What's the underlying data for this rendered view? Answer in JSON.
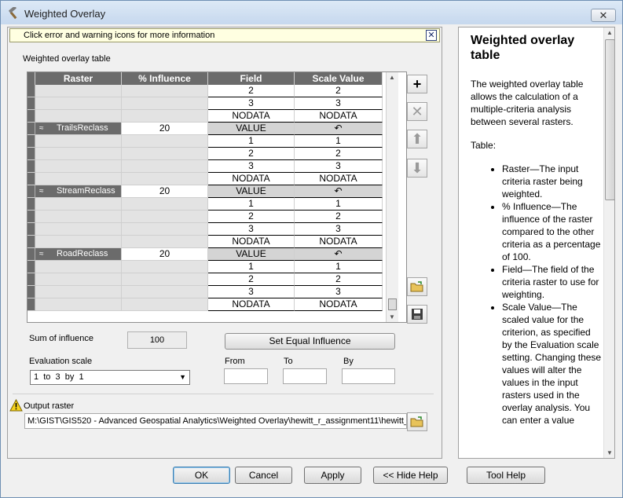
{
  "window": {
    "title": "Weighted Overlay",
    "close_glyph": "✕"
  },
  "info_bar": {
    "text": "Click error and warning icons for more information",
    "close_glyph": "✕"
  },
  "table": {
    "caption": "Weighted overlay table",
    "headers": [
      "Raster",
      "% Influence",
      "Field",
      "Scale Value"
    ],
    "value_rows_top": [
      {
        "field": "2",
        "scale": "2"
      },
      {
        "field": "3",
        "scale": "3"
      },
      {
        "field": "NODATA",
        "scale": "NODATA"
      }
    ],
    "groups": [
      {
        "raster": "TrailsReclass",
        "influence": "20",
        "field": "VALUE",
        "scale": "↶",
        "rows": [
          {
            "field": "1",
            "scale": "1"
          },
          {
            "field": "2",
            "scale": "2"
          },
          {
            "field": "3",
            "scale": "3"
          },
          {
            "field": "NODATA",
            "scale": "NODATA"
          }
        ]
      },
      {
        "raster": "StreamReclass",
        "influence": "20",
        "field": "VALUE",
        "scale": "↶",
        "rows": [
          {
            "field": "1",
            "scale": "1"
          },
          {
            "field": "2",
            "scale": "2"
          },
          {
            "field": "3",
            "scale": "3"
          },
          {
            "field": "NODATA",
            "scale": "NODATA"
          }
        ]
      },
      {
        "raster": "RoadReclass",
        "influence": "20",
        "field": "VALUE",
        "scale": "↶",
        "rows": [
          {
            "field": "1",
            "scale": "1"
          },
          {
            "field": "2",
            "scale": "2"
          },
          {
            "field": "3",
            "scale": "3"
          },
          {
            "field": "NODATA",
            "scale": "NODATA"
          }
        ]
      }
    ],
    "group_chevron": "≈"
  },
  "side_buttons": {
    "add": "+",
    "remove": "✕",
    "up": "⬆",
    "down": "⬇"
  },
  "sum_of_influence": {
    "label": "Sum of influence",
    "value": "100"
  },
  "set_equal_label": "Set Equal Influence",
  "evaluation_scale": {
    "label": "Evaluation scale",
    "value": "1  to  3  by  1",
    "caret": "▼"
  },
  "range_labels": {
    "from": "From",
    "to": "To",
    "by": "By"
  },
  "output": {
    "label": "Output raster",
    "path": "M:\\GIST\\GIS520 - Advanced Geospatial Analytics\\Weighted Overlay\\hewitt_r_assignment11\\hewitt_"
  },
  "help": {
    "title": "Weighted overlay table",
    "intro": "The weighted overlay table allows the calculation of a multiple-criteria analysis between several rasters.",
    "table_heading": "Table:",
    "items": [
      "Raster—The input criteria raster being weighted.",
      "% Influence—The influence of the raster compared to the other criteria as a percentage of 100.",
      "Field—The field of the criteria raster to use for weighting.",
      "Scale Value—The scaled value for the criterion, as specified by the Evaluation scale setting. Changing these values will alter the values in the input rasters used in the overlay analysis. You can enter a value"
    ]
  },
  "footer": {
    "ok": "OK",
    "cancel": "Cancel",
    "apply": "Apply",
    "hide_help": "<< Hide Help",
    "tool_help": "Tool Help"
  },
  "scroll_glyphs": {
    "up": "▲",
    "down": "▼"
  }
}
